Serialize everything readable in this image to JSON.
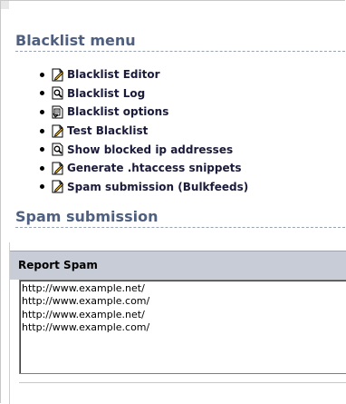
{
  "blacklist_menu": {
    "title": "Blacklist menu",
    "items": [
      {
        "label": "Blacklist Editor",
        "icon": "edit-page-icon"
      },
      {
        "label": "Blacklist Log",
        "icon": "search-page-icon"
      },
      {
        "label": "Blacklist options",
        "icon": "settings-page-icon"
      },
      {
        "label": "Test Blacklist",
        "icon": "edit-page-icon"
      },
      {
        "label": "Show blocked ip addresses",
        "icon": "search-page-icon"
      },
      {
        "label": "Generate .htaccess snippets",
        "icon": "edit-page-icon"
      },
      {
        "label": "Spam submission (Bulkfeeds)",
        "icon": "edit-page-icon"
      }
    ]
  },
  "spam_submission": {
    "title": "Spam submission",
    "report_header": "Report Spam",
    "textarea_value": "http://www.example.net/\nhttp://www.example.com/\nhttp://www.example.net/\nhttp://www.example.com/"
  },
  "colors": {
    "heading": "#4f5f7f",
    "header_bg": "#c8ccd6",
    "link": "#1a1a3a"
  }
}
